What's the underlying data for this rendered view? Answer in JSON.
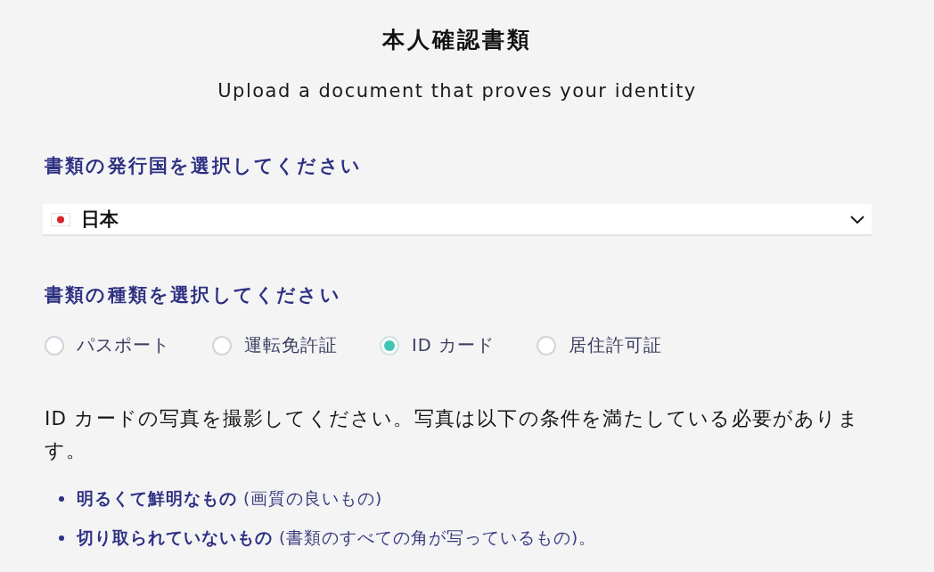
{
  "header": {
    "title": "本人確認書類",
    "subtitle": "Upload a document that proves your identity"
  },
  "country": {
    "label": "書類の発行国を選択してください",
    "value": "日本"
  },
  "document_type": {
    "label": "書類の種類を選択してください",
    "options": [
      {
        "label": "パスポート",
        "selected": false
      },
      {
        "label": "運転免許証",
        "selected": false
      },
      {
        "label": "ID カード",
        "selected": true
      },
      {
        "label": "居住許可証",
        "selected": false
      }
    ]
  },
  "instructions": {
    "text": "ID カードの写真を撮影してください。写真は以下の条件を満たしている必要があります。",
    "requirements": [
      "**明るくて鮮明なもの** (画質の良いもの)",
      "**切り取られていないもの** (書類のすべての角が写っているもの)。"
    ]
  }
}
